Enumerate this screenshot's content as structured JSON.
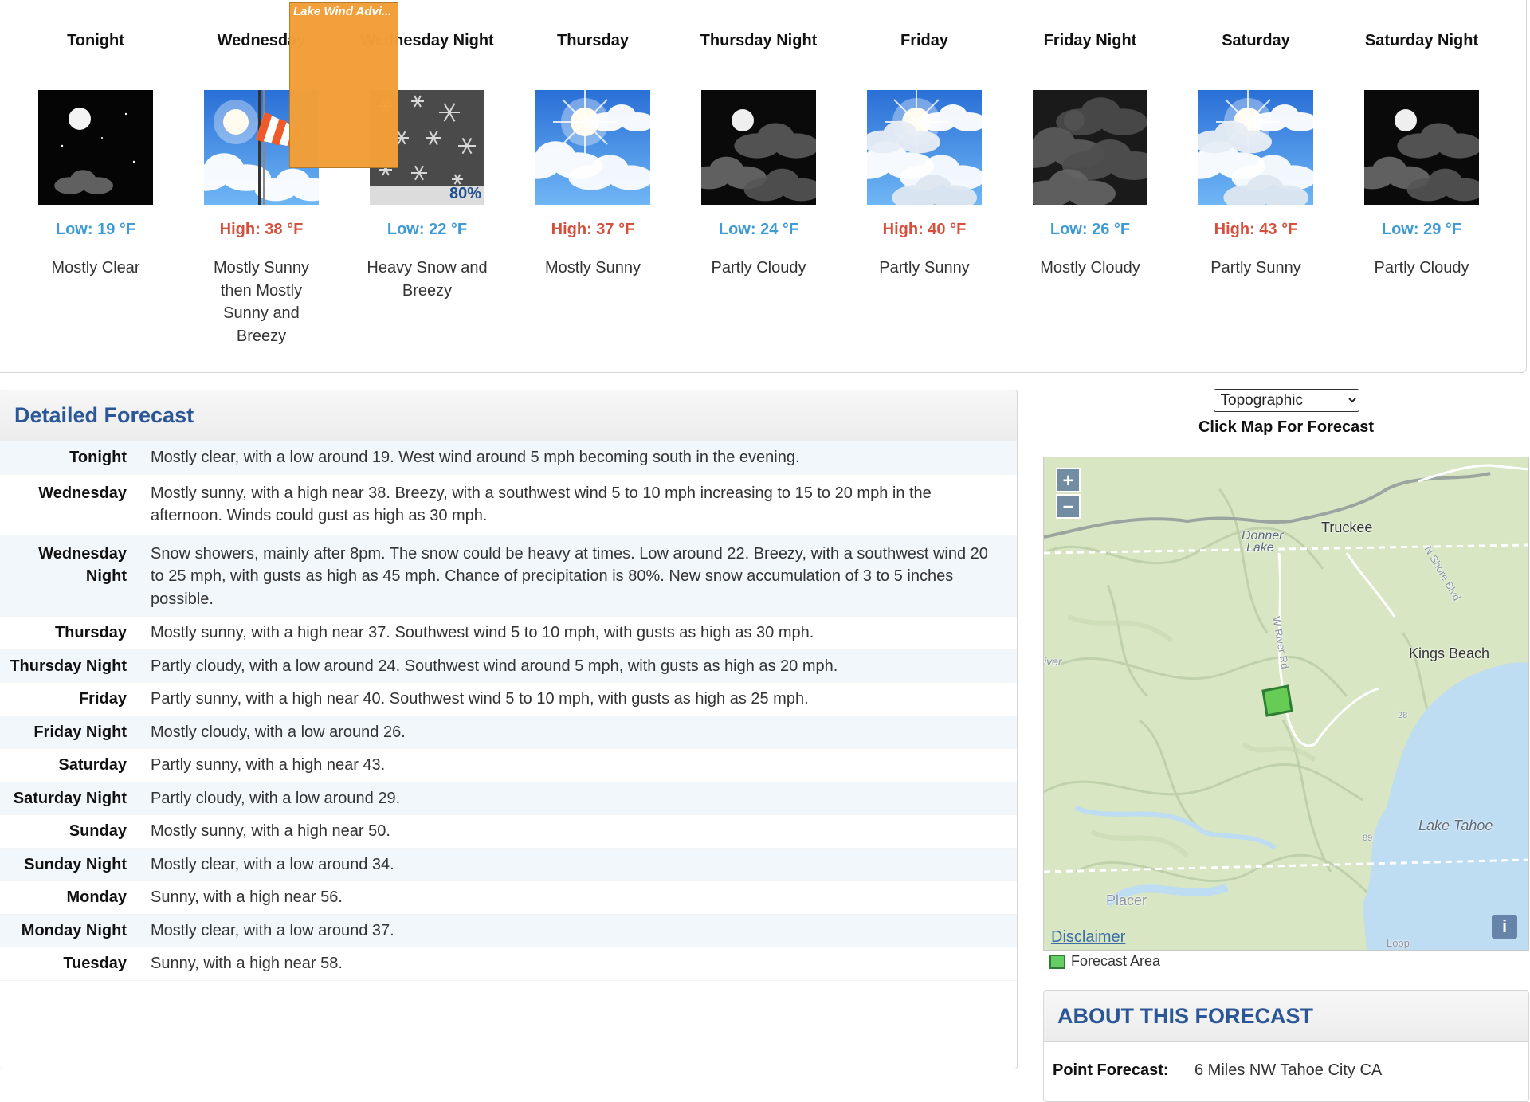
{
  "hazard_label": "Lake Wind Advi...",
  "periods": [
    {
      "name": "Tonight",
      "temp": "Low: 19 °F",
      "kind": "low",
      "short": "Mostly Clear",
      "icon": "night-clear-icon"
    },
    {
      "name": "Wednesday",
      "temp": "High: 38 °F",
      "kind": "high",
      "short": "Mostly Sunny then Mostly Sunny and Breezy",
      "icon": "sunny-windsock-icon"
    },
    {
      "name": "Wednesday Night",
      "temp": "Low: 22 °F",
      "kind": "low",
      "short": "Heavy Snow and Breezy",
      "icon": "snow-icon",
      "pop": "80%"
    },
    {
      "name": "Thursday",
      "temp": "High: 37 °F",
      "kind": "high",
      "short": "Mostly Sunny",
      "icon": "sunny-clouds-icon"
    },
    {
      "name": "Thursday Night",
      "temp": "Low: 24 °F",
      "kind": "low",
      "short": "Partly Cloudy",
      "icon": "night-partly-cloudy-icon"
    },
    {
      "name": "Friday",
      "temp": "High: 40 °F",
      "kind": "high",
      "short": "Partly Sunny",
      "icon": "partly-sunny-icon"
    },
    {
      "name": "Friday Night",
      "temp": "Low: 26 °F",
      "kind": "low",
      "short": "Mostly Cloudy",
      "icon": "night-mostly-cloudy-icon"
    },
    {
      "name": "Saturday",
      "temp": "High: 43 °F",
      "kind": "high",
      "short": "Partly Sunny",
      "icon": "partly-sunny-icon"
    },
    {
      "name": "Saturday Night",
      "temp": "Low: 29 °F",
      "kind": "low",
      "short": "Partly Cloudy",
      "icon": "night-partly-cloudy-icon"
    }
  ],
  "detailed": {
    "title": "Detailed Forecast",
    "rows": [
      {
        "label": "Tonight",
        "text": "Mostly clear, with a low around 19. West wind around 5 mph becoming south in the evening."
      },
      {
        "label": "Wednesday",
        "text": "Mostly sunny, with a high near 38. Breezy, with a southwest wind 5 to 10 mph increasing to 15 to 20 mph in the afternoon. Winds could gust as high as 30 mph."
      },
      {
        "label": "Wednesday Night",
        "text": "Snow showers, mainly after 8pm. The snow could be heavy at times. Low around 22. Breezy, with a southwest wind 20 to 25 mph, with gusts as high as 45 mph. Chance of precipitation is 80%. New snow accumulation of 3 to 5 inches possible."
      },
      {
        "label": "Thursday",
        "text": "Mostly sunny, with a high near 37. Southwest wind 5 to 10 mph, with gusts as high as 30 mph."
      },
      {
        "label": "Thursday Night",
        "text": "Partly cloudy, with a low around 24. Southwest wind around 5 mph, with gusts as high as 20 mph."
      },
      {
        "label": "Friday",
        "text": "Partly sunny, with a high near 40. Southwest wind 5 to 10 mph, with gusts as high as 25 mph."
      },
      {
        "label": "Friday Night",
        "text": "Mostly cloudy, with a low around 26."
      },
      {
        "label": "Saturday",
        "text": "Partly sunny, with a high near 43."
      },
      {
        "label": "Saturday Night",
        "text": "Partly cloudy, with a low around 29."
      },
      {
        "label": "Sunday",
        "text": "Mostly sunny, with a high near 50."
      },
      {
        "label": "Sunday Night",
        "text": "Mostly clear, with a low around 34."
      },
      {
        "label": "Monday",
        "text": "Sunny, with a high near 56."
      },
      {
        "label": "Monday Night",
        "text": "Mostly clear, with a low around 37."
      },
      {
        "label": "Tuesday",
        "text": "Sunny, with a high near 58."
      }
    ]
  },
  "map": {
    "basemap_selected": "Topographic",
    "hint": "Click Map For Forecast",
    "zoom_in": "+",
    "zoom_out": "−",
    "disclaimer": "Disclaimer",
    "info": "i",
    "labels": {
      "truckee": "Truckee",
      "donner": "Donner",
      "donner2": "Lake",
      "kings_beach": "Kings Beach",
      "lake_tahoe": "Lake Tahoe",
      "placer": "Placer",
      "n_shore": "N Shore Blvd",
      "w_river": "W River Rd",
      "river": "iver",
      "loop": "Loop",
      "route_28": "28",
      "route_89": "89"
    },
    "legend": "Forecast Area"
  },
  "about": {
    "title": "ABOUT THIS FORECAST",
    "point_label": "Point Forecast:",
    "point_value": "6 Miles NW Tahoe City CA"
  },
  "colors": {
    "low_temp": "#3f9bd6",
    "high_temp": "#d4503c",
    "heading": "#2b5797",
    "hazard": "#f29f38"
  }
}
